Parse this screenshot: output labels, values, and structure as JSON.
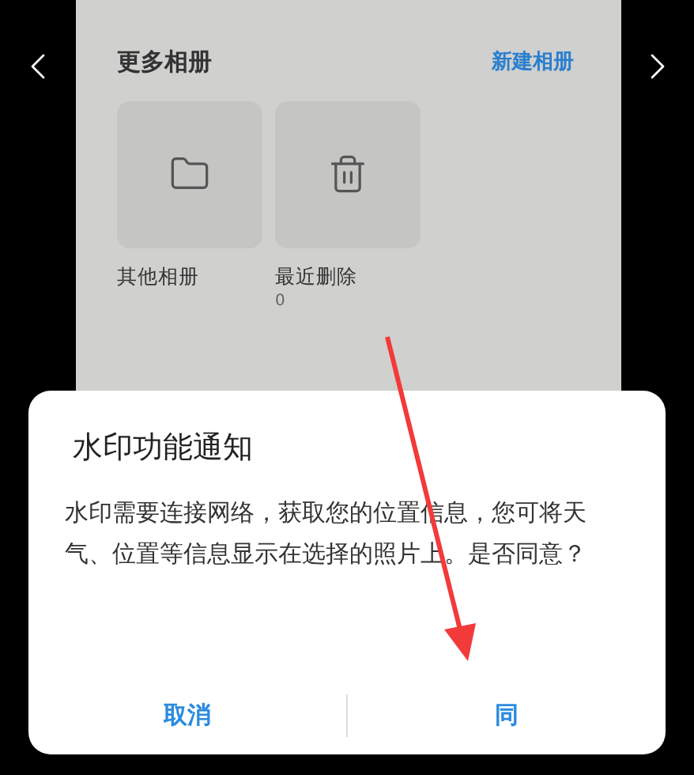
{
  "albums_panel": {
    "title": "更多相册",
    "new_album": "新建相册",
    "albums": [
      {
        "kind": "folder",
        "name": "其他相册"
      },
      {
        "kind": "trash",
        "name": "最近删除",
        "count": "0"
      }
    ]
  },
  "dialog": {
    "title": "水印功能通知",
    "message": "水印需要连接网络，获取您的位置信息，您可将天气、位置等信息显示在选择的照片上。是否同意？",
    "buttons": [
      "取消",
      "同"
    ]
  }
}
